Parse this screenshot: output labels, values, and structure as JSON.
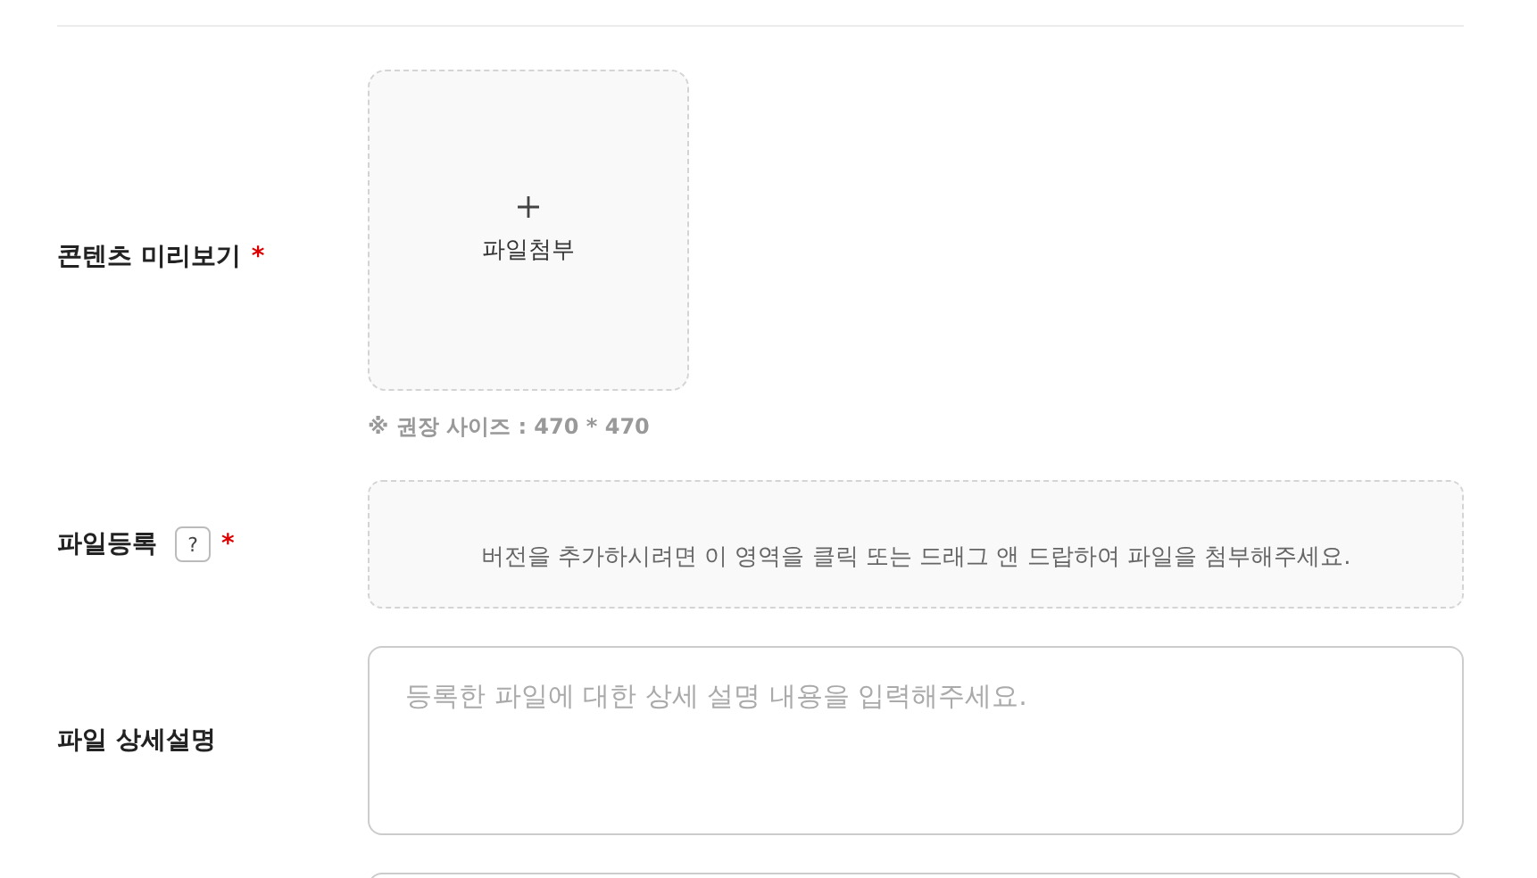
{
  "fields": [
    {
      "kind": "image_upload",
      "label": "콘텐츠 미리보기",
      "required_mark": "*",
      "upload_label": "파일첨부",
      "note": "※ 권장 사이즈 : 470 * 470"
    },
    {
      "kind": "file_drop",
      "label": "파일등록",
      "help": "?",
      "required_mark": "*",
      "drop_text": "버전을 추가하시려면 이 영역을 클릭 또는 드래그 앤 드랍하여 파일을 첨부해주세요."
    },
    {
      "kind": "textarea",
      "label": "파일 상세설명",
      "placeholder": "등록한 파일에 대한 상세 설명 내용을 입력해주세요."
    },
    {
      "kind": "textarea"
    }
  ]
}
